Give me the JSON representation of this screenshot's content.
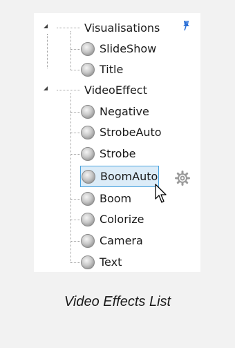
{
  "tree": {
    "categories": [
      {
        "label": "Visualisations",
        "expanded": true,
        "items": [
          "SlideShow",
          "Title"
        ]
      },
      {
        "label": "VideoEffect",
        "expanded": true,
        "items": [
          "Negative",
          "StrobeAuto",
          "Strobe",
          "BoomAuto",
          "Boom",
          "Colorize",
          "Camera",
          "Text"
        ]
      }
    ],
    "selected_item": "BoomAuto"
  },
  "caption": "Video Effects List",
  "icons": {
    "pin": "pin-icon",
    "gear": "gear-icon",
    "cursor": "mouse-pointer-icon",
    "item": "orb-icon",
    "expander": "expanded-triangle-icon"
  },
  "colors": {
    "selection_fill": "#dcecf8",
    "selection_border": "#4aa3df",
    "pin_blue": "#2a6fd6"
  }
}
